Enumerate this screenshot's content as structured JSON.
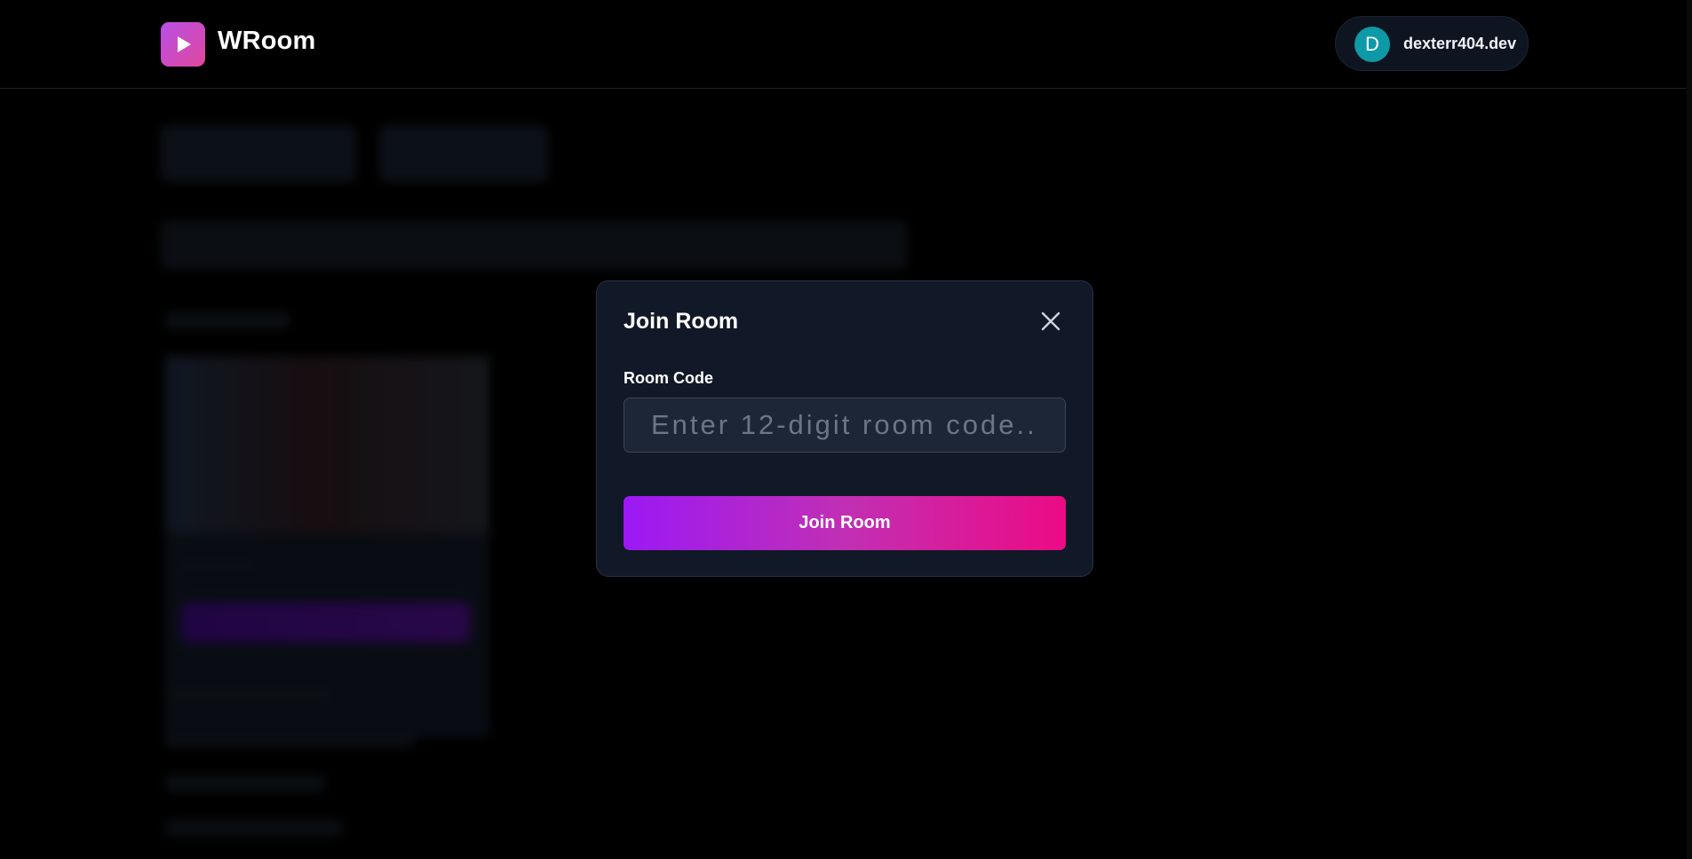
{
  "app": {
    "name": "WRoom",
    "brand_gradient": [
      "#b84fe8",
      "#e0489b"
    ]
  },
  "user": {
    "initial": "D",
    "name": "dexterr404.dev",
    "avatar_color": "#0d9aa6"
  },
  "modal": {
    "title": "Join Room",
    "field_label": "Room Code",
    "input_value": "",
    "input_placeholder": "Enter 12-digit room code...",
    "submit_label": "Join Room",
    "submit_gradient": [
      "#9b19f5",
      "#ec0b84"
    ]
  },
  "icons": {
    "logo": "play-icon",
    "close": "close-icon"
  }
}
